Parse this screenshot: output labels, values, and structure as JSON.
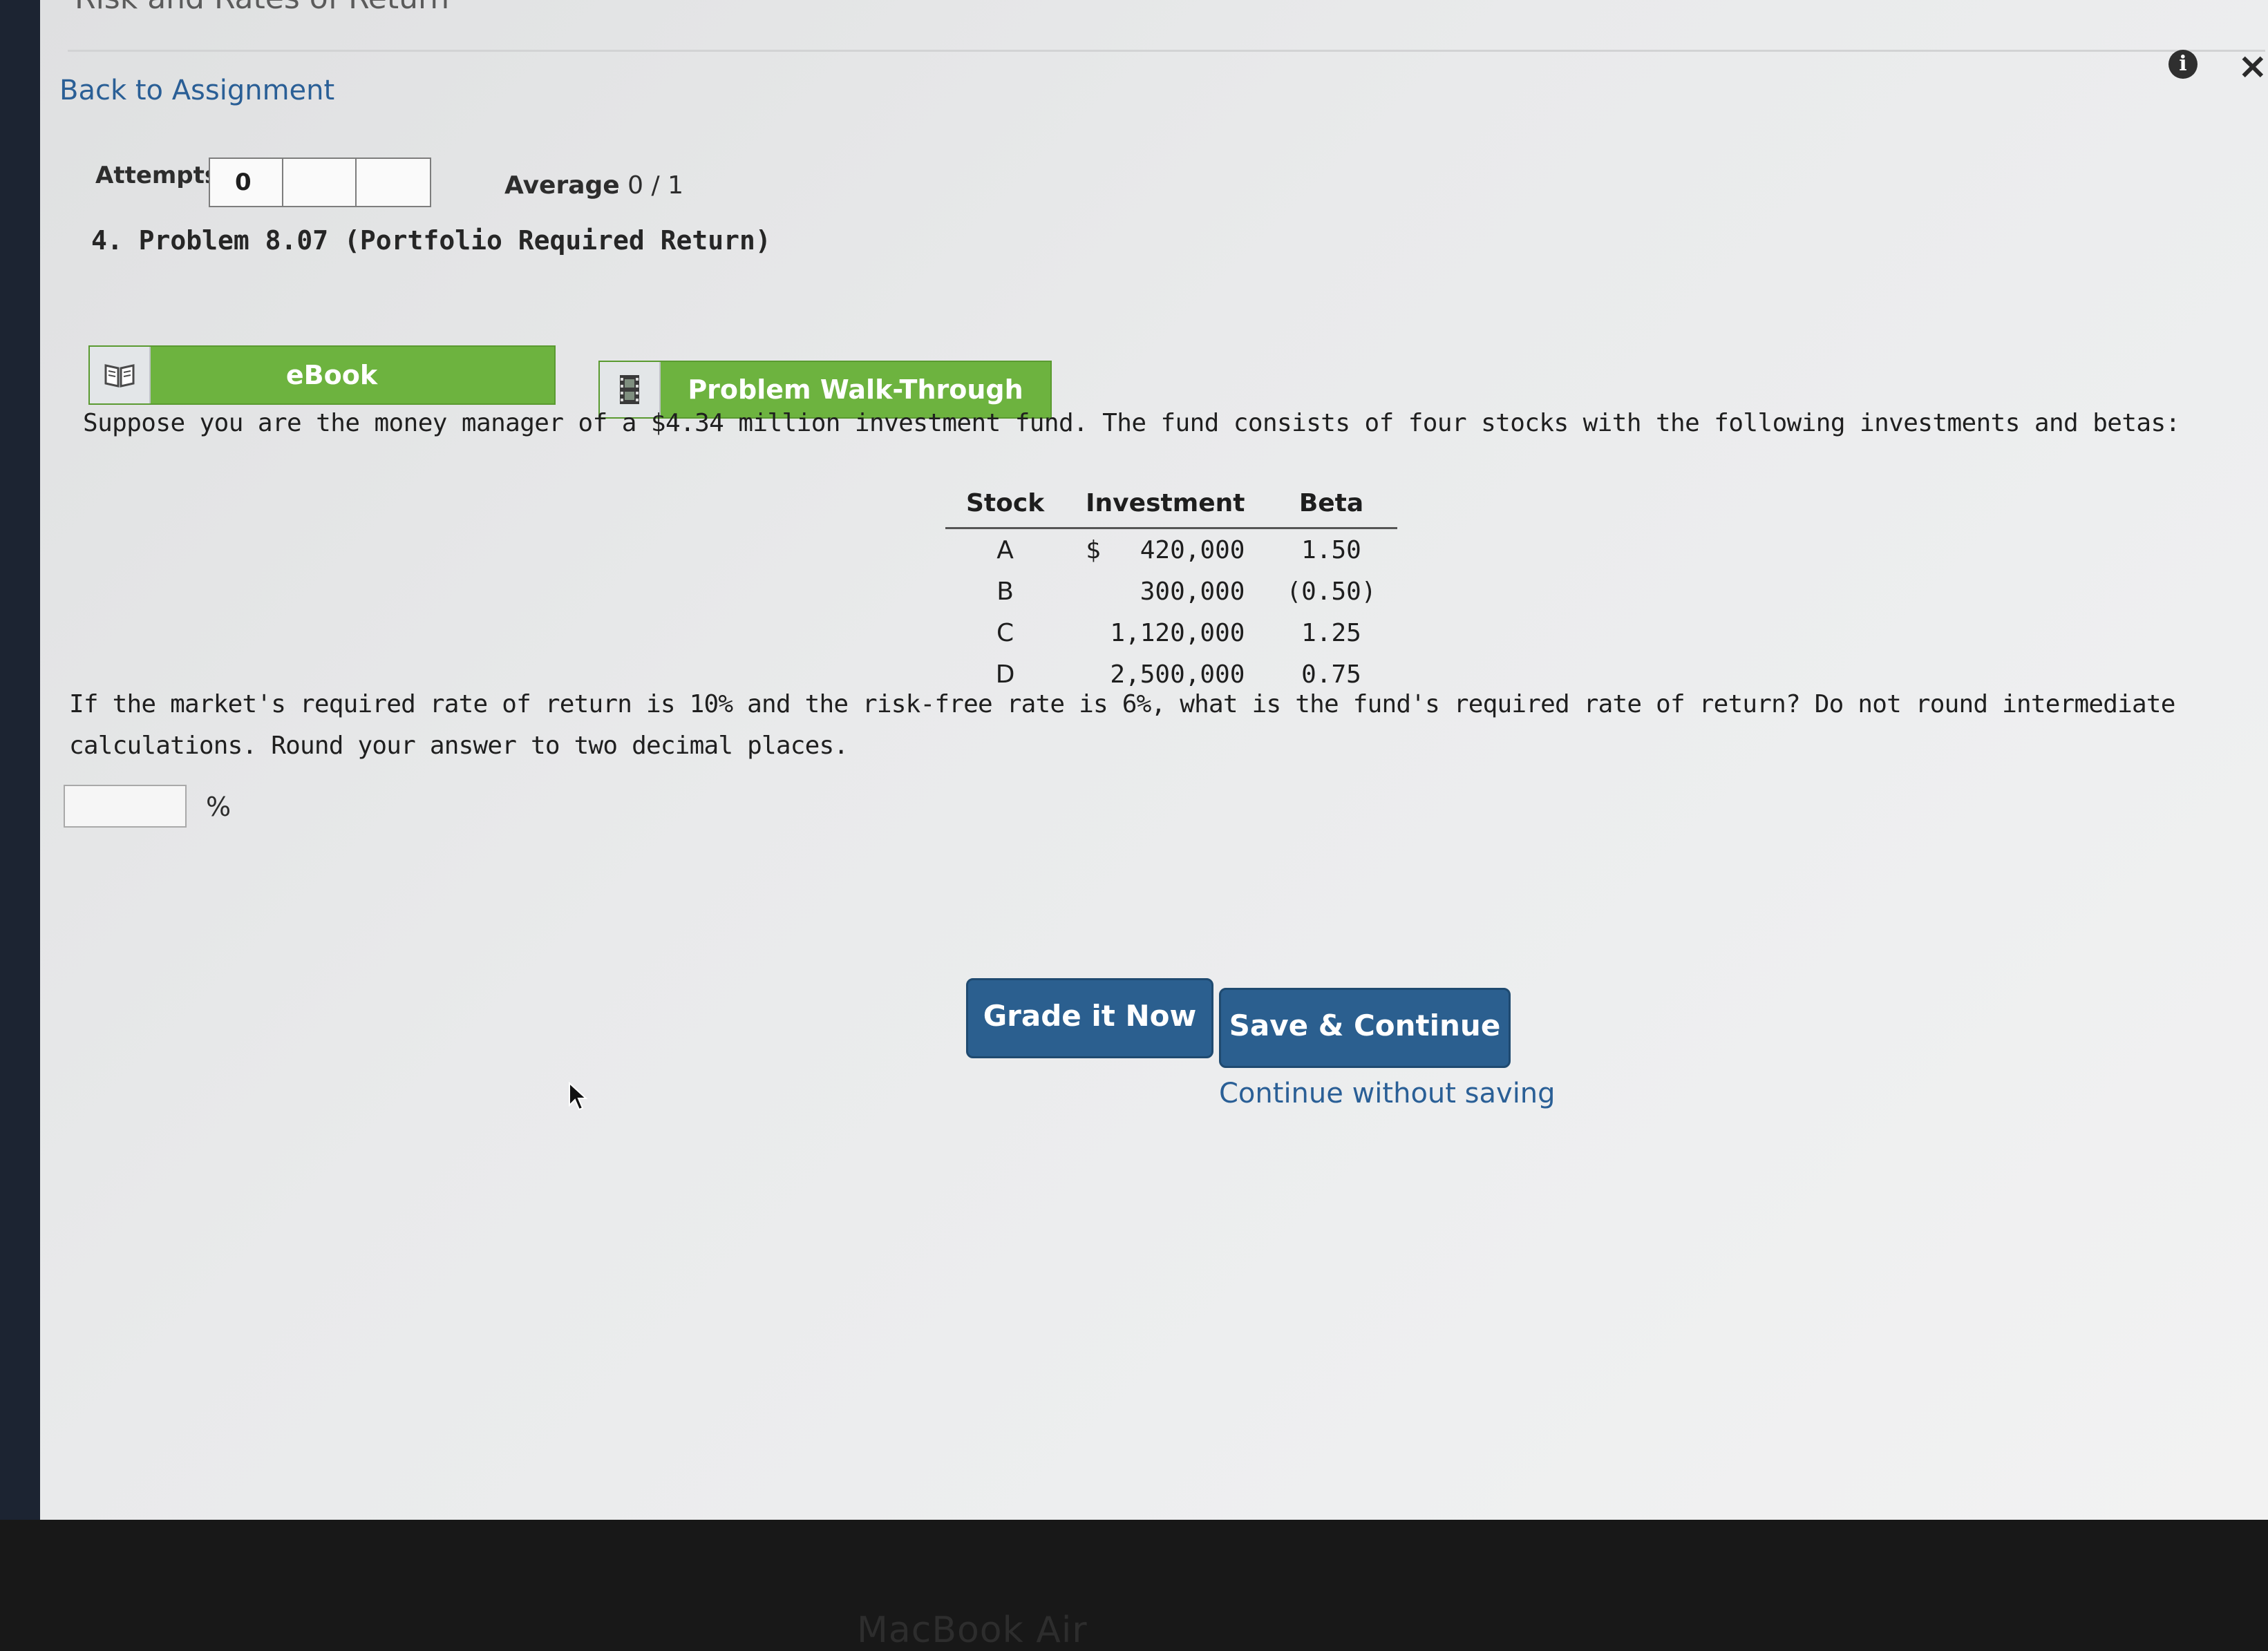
{
  "header": {
    "assignment_title": "Risk and Rates of Return",
    "back_link": "Back to Assignment",
    "info_icon": "i",
    "close_icon": "×"
  },
  "attempts": {
    "label": "Attempts",
    "boxes": [
      "0",
      "",
      ""
    ],
    "average_label": "Average",
    "average_value": "0 / 1"
  },
  "problem": {
    "title": "4. Problem 8.07 (Portfolio Required Return)",
    "buttons": {
      "ebook": "eBook",
      "walkthrough": "Problem Walk-Through"
    },
    "intro": "Suppose you are the money manager of a $4.34 million investment fund. The fund consists of four stocks with the following investments and betas:",
    "table": {
      "headers": [
        "Stock",
        "Investment",
        "Beta"
      ],
      "rows": [
        {
          "stock": "A",
          "currency": "$",
          "investment": "420,000",
          "beta": "1.50"
        },
        {
          "stock": "B",
          "currency": "",
          "investment": "300,000",
          "beta": "(0.50)"
        },
        {
          "stock": "C",
          "currency": "",
          "investment": "1,120,000",
          "beta": "1.25"
        },
        {
          "stock": "D",
          "currency": "",
          "investment": "2,500,000",
          "beta": "0.75"
        }
      ]
    },
    "question": "If the market's required rate of return is 10% and the risk-free rate is 6%, what is the fund's required rate of return? Do not round intermediate calculations. Round your answer to two decimal places.",
    "answer_value": "",
    "answer_unit": "%"
  },
  "actions": {
    "grade": "Grade it Now",
    "save": "Save & Continue",
    "continue_without": "Continue without saving"
  },
  "device": {
    "label": "MacBook Air"
  },
  "colors": {
    "green_button": "#6db33f",
    "blue_button": "#2b5f8f",
    "link": "#2a5f96"
  }
}
